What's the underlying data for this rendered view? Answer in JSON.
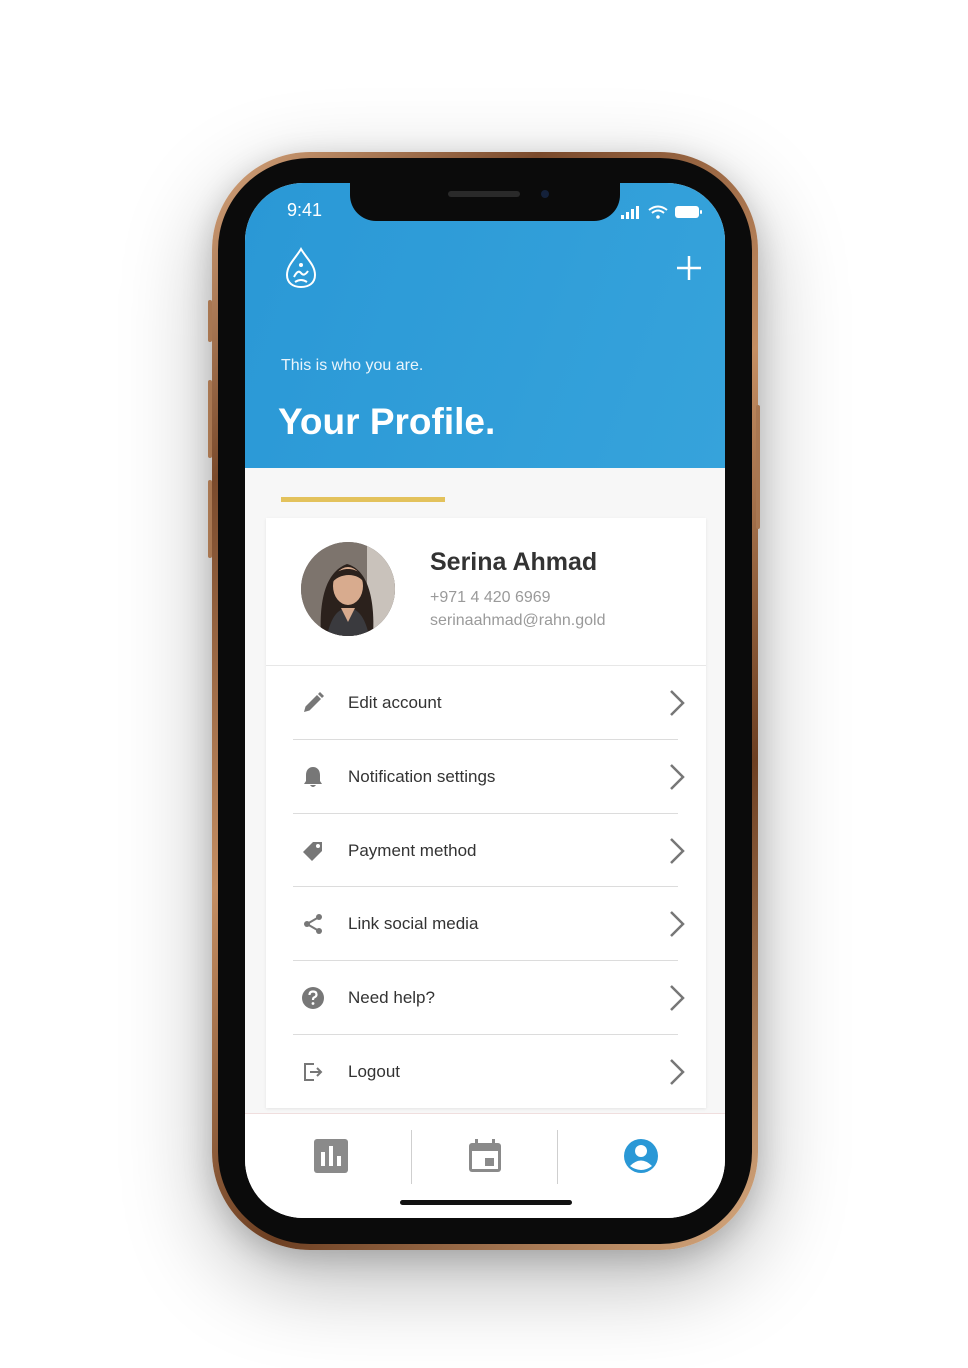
{
  "status_bar": {
    "time": "9:41"
  },
  "header": {
    "subtitle": "This is who you are.",
    "title": "Your Profile."
  },
  "profile": {
    "name": "Serina Ahmad",
    "phone": "+971 4 420 6969",
    "email": "serinaahmad@rahn.gold"
  },
  "menu": {
    "items": [
      {
        "label": "Edit account",
        "icon": "pencil-icon"
      },
      {
        "label": "Notification settings",
        "icon": "bell-icon"
      },
      {
        "label": "Payment method",
        "icon": "tag-icon"
      },
      {
        "label": "Link social media",
        "icon": "share-icon"
      },
      {
        "label": "Need help?",
        "icon": "help-circle-icon"
      },
      {
        "label": "Logout",
        "icon": "logout-icon"
      }
    ]
  },
  "tabbar": {
    "tabs": [
      {
        "name": "stats",
        "icon": "bar-chart-icon",
        "active": false
      },
      {
        "name": "calendar",
        "icon": "calendar-icon",
        "active": false
      },
      {
        "name": "profile",
        "icon": "user-circle-icon",
        "active": true
      }
    ]
  },
  "colors": {
    "header_blue": "#2a98d6",
    "accent_gold": "#e3c25c",
    "active_tab": "#2a98d6",
    "inactive_tab": "#8a8a8a"
  }
}
